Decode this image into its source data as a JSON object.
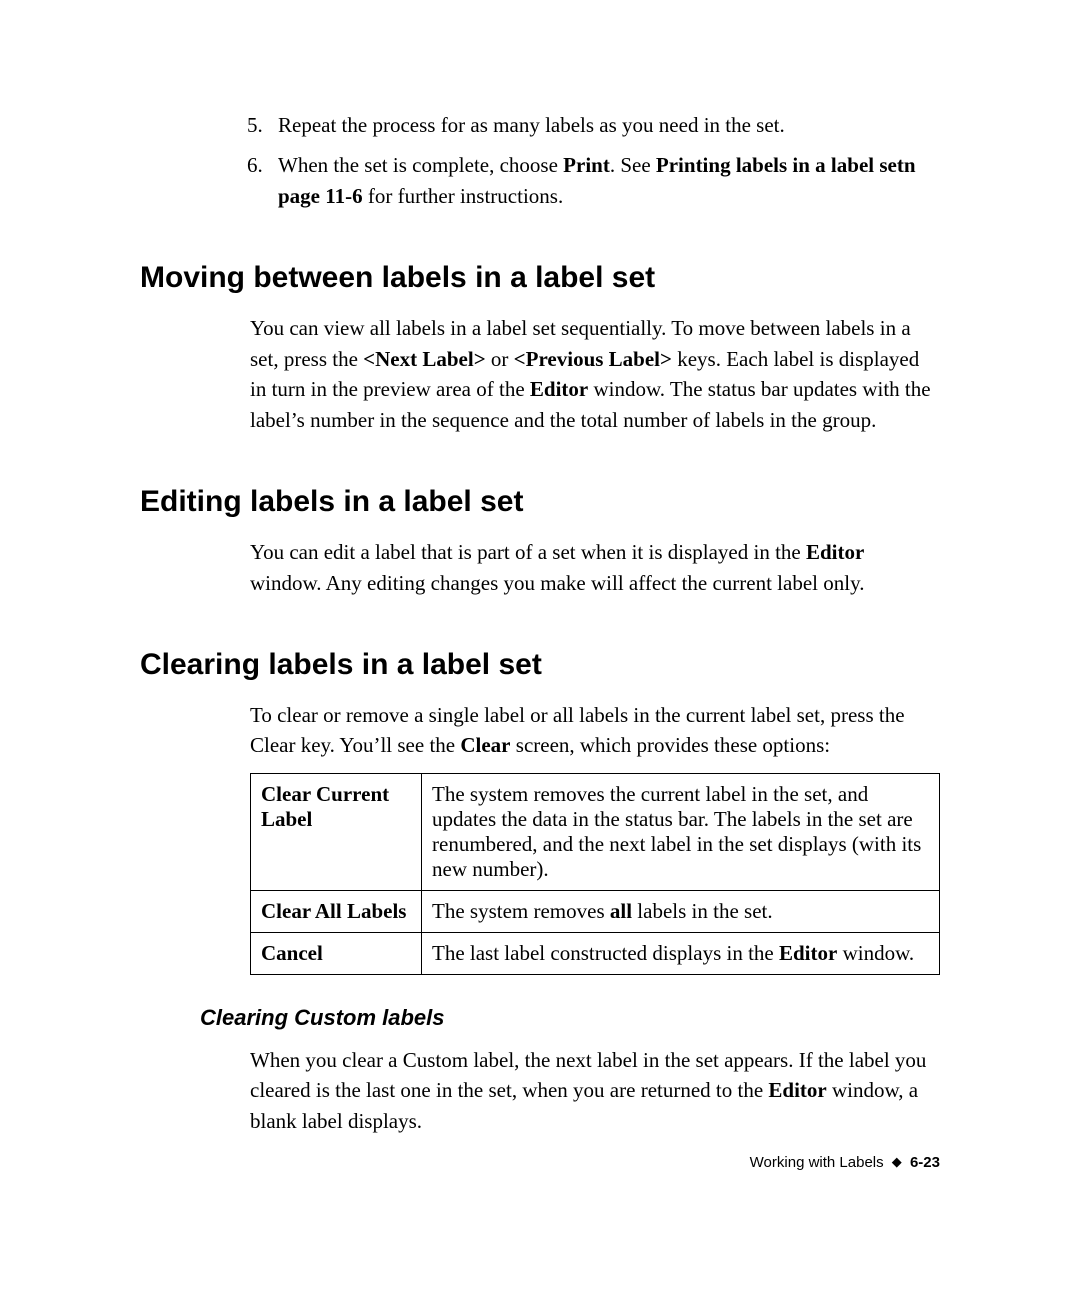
{
  "steps": {
    "item5": {
      "num": "5.",
      "text": "Repeat the process for as many labels as you need in the set."
    },
    "item6": {
      "num": "6.",
      "prefix": "When the set is complete, choose ",
      "print": "Print",
      "middle": ". See ",
      "ref": "Printing labels in a label setn page 11-6",
      "suffix": " for further instructions."
    }
  },
  "moving": {
    "heading": "Moving between labels in a label set",
    "p": {
      "t1": "You can view all labels in a label set sequentially. To move between labels in a set, press the ",
      "k1": "<Next Label>",
      "t2": " or ",
      "k2": "<Previous Label>",
      "t3": " keys. Each label is displayed in turn in the preview area of the ",
      "k3": "Editor",
      "t4": " window. The status bar updates with the label’s number in the sequence and the total number of labels in the group."
    }
  },
  "editing": {
    "heading": "Editing labels in a label set",
    "p": {
      "t1": "You can edit a label that is part of a set when it is displayed in the ",
      "k1": "Editor",
      "t2": " window. Any editing changes you make will affect the current label only."
    }
  },
  "clearing": {
    "heading": "Clearing labels in a label set",
    "intro": {
      "t1": "To clear or remove a single label or all labels in the current label set, press the Clear key. You’ll see the ",
      "k1": "Clear",
      "t2": " screen, which provides these options:"
    },
    "table": {
      "r1": {
        "label": "Clear Current Label",
        "desc": "The system removes the current label in the set, and updates the data in the status bar. The labels in the set are renumbered, and the next label in the set displays (with its new number)."
      },
      "r2": {
        "label": "Clear All Labels",
        "d1": "The system removes ",
        "d2": "all",
        "d3": " labels in the set."
      },
      "r3": {
        "label": "Cancel",
        "d1": "The last label constructed displays in the ",
        "d2": "Editor",
        "d3": " window."
      }
    },
    "sub": {
      "heading": "Clearing Custom labels",
      "p": {
        "t1": "When you clear a Custom label, the next label in the set appears. If the label you cleared is the last one in the set, when you are returned to the ",
        "k1": "Editor",
        "t2": " window, a blank label displays."
      }
    }
  },
  "footer": {
    "section": "Working with Labels",
    "page": "6-23"
  }
}
